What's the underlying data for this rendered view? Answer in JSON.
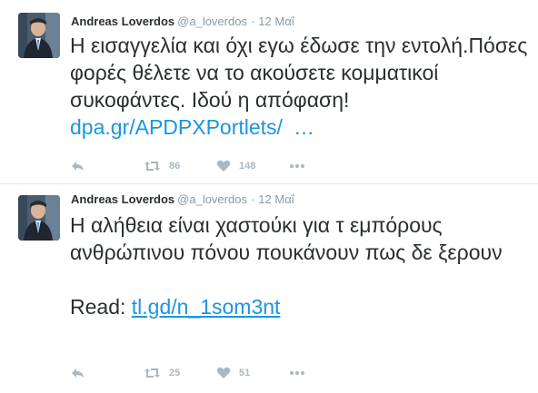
{
  "tweets": [
    {
      "fullname": "Andreas Loverdos",
      "username": "@a_loverdos",
      "separator": "·",
      "timestamp": "12 Μαΐ",
      "text": "Η εισαγγελία και όχι εγω έδωσε την εντολή.Πόσες φορές θέλετε να το ακούσετε κομματικοί συκοφάντες. Ιδού η απόφαση!",
      "link": "dpa.gr/APDPXPortlets/",
      "ellipsis": "…",
      "retweets": "86",
      "likes": "148"
    },
    {
      "fullname": "Andreas Loverdos",
      "username": "@a_loverdos",
      "separator": "·",
      "timestamp": "12 Μαΐ",
      "text": "Η αλήθεια είναι χαστούκι για τ εμπόρους ανθρώπινου πόνου πουκάνουν πως δε ξερουν",
      "read_label": "Read:",
      "link": "tl.gd/n_1som3nt",
      "retweets": "25",
      "likes": "51"
    }
  ],
  "icons": {
    "reply": "reply-icon",
    "retweet": "retweet-icon",
    "like": "heart-icon",
    "more": "more-dots-icon"
  },
  "colors": {
    "link": "#1b95e0",
    "action": "#aab8c2",
    "meta": "#8899a6",
    "text": "#292f33"
  }
}
